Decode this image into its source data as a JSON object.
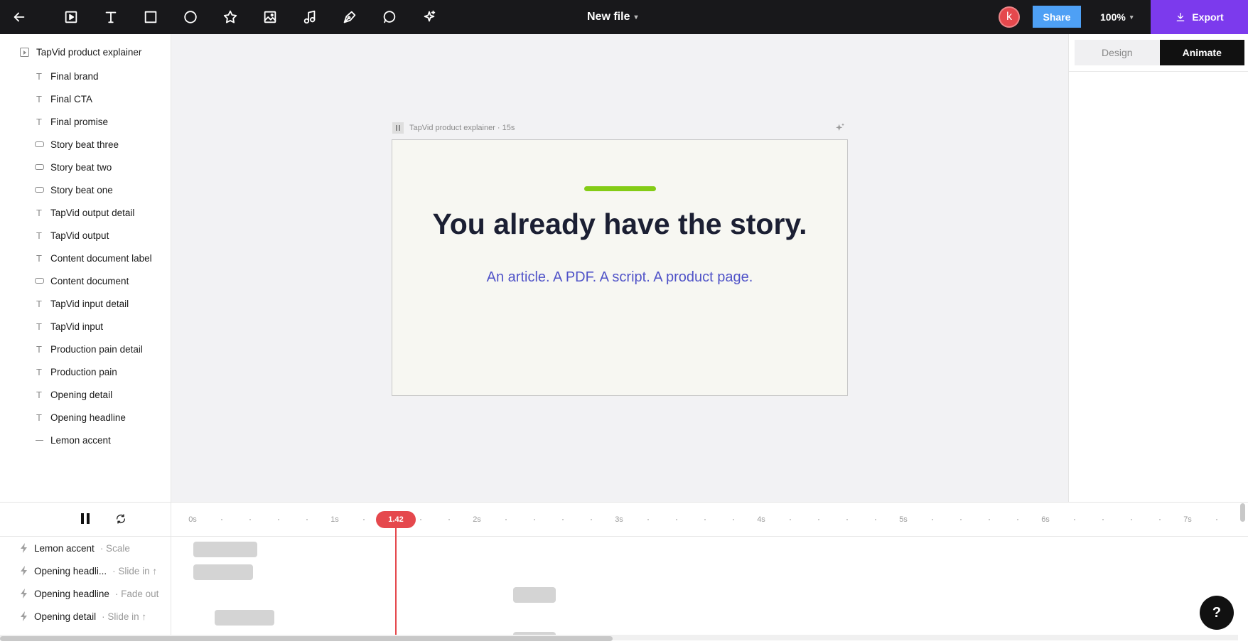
{
  "toolbar": {
    "tools": [
      {
        "name": "back-arrow-icon"
      },
      {
        "name": "video-frame-icon"
      },
      {
        "name": "text-tool-icon"
      },
      {
        "name": "rectangle-tool-icon"
      },
      {
        "name": "ellipse-tool-icon"
      },
      {
        "name": "star-tool-icon"
      },
      {
        "name": "image-tool-icon"
      },
      {
        "name": "music-note-icon"
      },
      {
        "name": "pen-tool-icon"
      },
      {
        "name": "comment-icon"
      },
      {
        "name": "sparkle-ai-icon"
      }
    ],
    "file_title": "New file",
    "avatar_initial": "k",
    "share_label": "Share",
    "zoom": "100%",
    "export_label": "Export"
  },
  "layers": {
    "root": "TapVid product explainer",
    "items": [
      {
        "label": "Final brand",
        "icon": "text"
      },
      {
        "label": "Final CTA",
        "icon": "text"
      },
      {
        "label": "Final promise",
        "icon": "text"
      },
      {
        "label": "Story beat three",
        "icon": "rect"
      },
      {
        "label": "Story beat two",
        "icon": "rect"
      },
      {
        "label": "Story beat one",
        "icon": "rect"
      },
      {
        "label": "TapVid output detail",
        "icon": "text"
      },
      {
        "label": "TapVid output",
        "icon": "text"
      },
      {
        "label": "Content document label",
        "icon": "text"
      },
      {
        "label": "Content document",
        "icon": "rect"
      },
      {
        "label": "TapVid input detail",
        "icon": "text"
      },
      {
        "label": "TapVid input",
        "icon": "text"
      },
      {
        "label": "Production pain detail",
        "icon": "text"
      },
      {
        "label": "Production pain",
        "icon": "text"
      },
      {
        "label": "Opening detail",
        "icon": "text"
      },
      {
        "label": "Opening headline",
        "icon": "text"
      },
      {
        "label": "Lemon accent",
        "icon": "line"
      }
    ]
  },
  "canvas": {
    "frame_label": "TapVid product explainer · 15s",
    "headline": "You already have the story.",
    "subline": "An article. A PDF. A script. A product page.",
    "accent_color": "#84cc16",
    "headline_color": "#1b1f33",
    "subline_color": "#5053c8"
  },
  "right_panel": {
    "tabs": [
      {
        "label": "Design",
        "active": false
      },
      {
        "label": "Animate",
        "active": true
      }
    ]
  },
  "timeline": {
    "ticks": [
      "0s",
      "1s",
      "2s",
      "3s",
      "4s",
      "5s",
      "6s",
      "7s"
    ],
    "playhead": "1.42",
    "tracks": [
      {
        "layer": "Lemon accent",
        "anim": "· Scale"
      },
      {
        "layer": "Opening headli...",
        "anim": "· Slide in ↑"
      },
      {
        "layer": "Opening headline",
        "anim": "· Fade out"
      },
      {
        "layer": "Opening detail",
        "anim": "· Slide in ↑"
      }
    ],
    "help_label": "?"
  }
}
